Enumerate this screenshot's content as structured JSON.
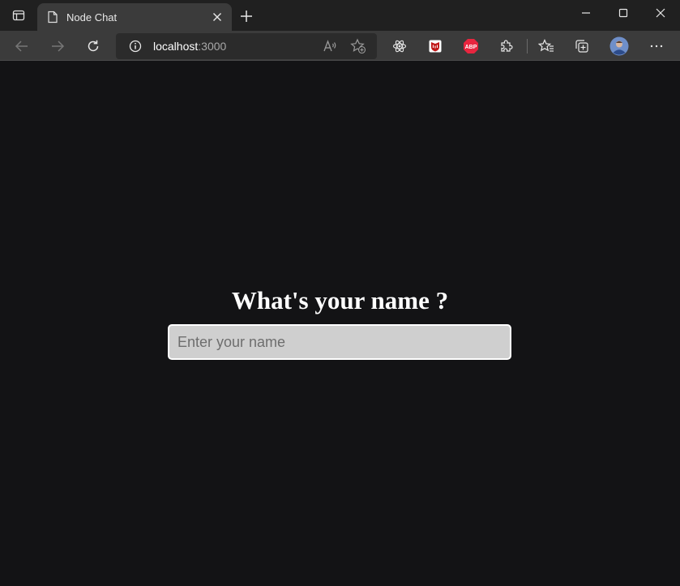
{
  "browser": {
    "tab": {
      "title": "Node Chat"
    },
    "address": {
      "host": "localhost",
      "port": ":3000"
    },
    "icons": {
      "tab_actions": "tab-actions-icon",
      "page": "page-icon",
      "close": "close-icon",
      "new_tab": "plus-icon",
      "back": "back-arrow-icon",
      "forward": "forward-arrow-icon",
      "refresh": "refresh-icon",
      "info": "info-icon",
      "read_aloud": "read-aloud-icon",
      "add_favorite": "add-favorite-icon",
      "react_devtools": "react-icon",
      "mcafee": "mcafee-icon",
      "adblock": "abp-icon",
      "extensions": "puzzle-icon",
      "favorites": "favorites-icon",
      "collections": "collections-icon",
      "profile": "avatar-icon",
      "more": "more-icon"
    },
    "adblock_label": "ABP"
  },
  "page": {
    "heading": "What's your name ?",
    "input_placeholder": "Enter your name",
    "input_value": ""
  },
  "colors": {
    "background": "#131315",
    "titlebar": "#202020",
    "toolbar": "#3b3b3b",
    "input_bg": "#cfcfcf",
    "adblock_red": "#e8253f",
    "mcafee_red": "#c01818"
  }
}
